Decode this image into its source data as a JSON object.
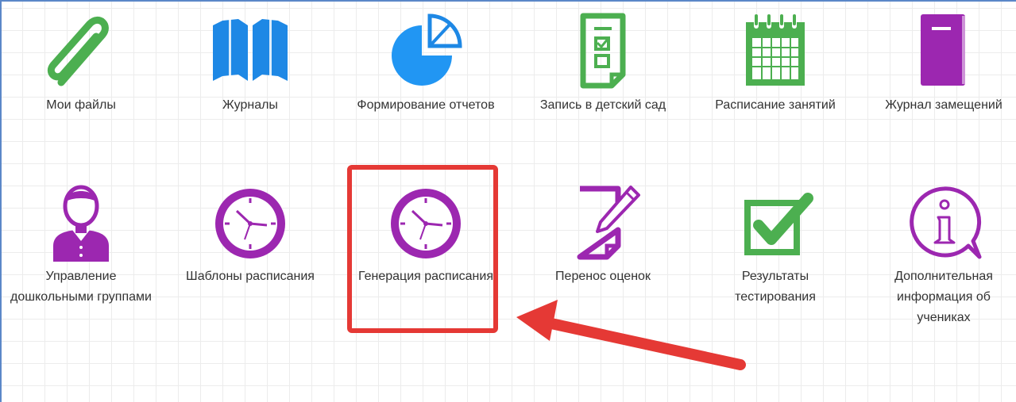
{
  "tiles": [
    {
      "label": "Мои файлы",
      "icon": "paperclip-icon"
    },
    {
      "label": "Журналы",
      "icon": "book-icon"
    },
    {
      "label": "Формирование отчетов",
      "icon": "pie-chart-icon"
    },
    {
      "label": "Запись в детский сад",
      "icon": "clipboard-checklist-icon"
    },
    {
      "label": "Расписание занятий",
      "icon": "calendar-icon"
    },
    {
      "label": "Журнал замещений",
      "icon": "notebook-icon"
    },
    {
      "label": "Управление дошкольными группами",
      "icon": "person-icon"
    },
    {
      "label": "Шаблоны расписания",
      "icon": "clock-icon"
    },
    {
      "label": "Генерация расписания",
      "icon": "clock-icon"
    },
    {
      "label": "Перенос оценок",
      "icon": "document-pencil-icon"
    },
    {
      "label": "Результаты тестирования",
      "icon": "checkbox-icon"
    },
    {
      "label": "Дополнительная информация об учениках",
      "icon": "info-bubble-icon"
    }
  ],
  "colors": {
    "green": "#4caf50",
    "blue": "#1e88e5",
    "purple": "#9c27b0",
    "highlight_red": "#e53935",
    "frame_blue": "#5b87c8"
  }
}
